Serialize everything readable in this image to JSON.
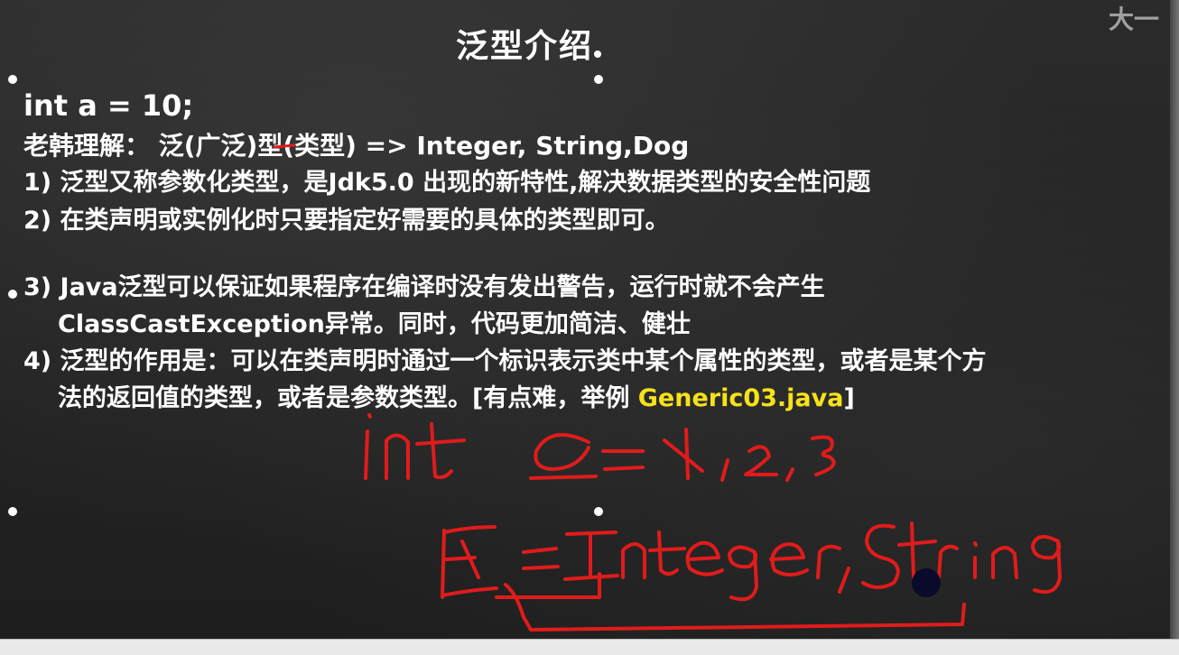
{
  "watermark": "大一",
  "title": "泛型介绍",
  "lines": {
    "l1": "int a = 10;",
    "l2": "老韩理解： 泛(广泛)型(类型) => Integer, String,Dog",
    "l3": "1) 泛型又称参数化类型，是Jdk5.0 出现的新特性,解决数据类型的安全性问题",
    "l4": "2) 在类声明或实例化时只要指定好需要的具体的类型即可。",
    "l5": "3) Java泛型可以保证如果程序在编译时没有发出警告，运行时就不会产生",
    "l6": "ClassCastException异常。同时，代码更加简洁、健壮",
    "l7": "4) 泛型的作用是：可以在类声明时通过一个标识表示类中某个属性的类型，或者是某个方",
    "l8_prefix": "法的返回值的类型，或者是参数类型。[有点难，举例 ",
    "l8_highlight": "Generic03.java",
    "l8_suffix": "]"
  },
  "handwriting": {
    "line1": "int a=1,2,3",
    "line2": "E=Integer,String"
  },
  "colors": {
    "text": "#ffffff",
    "highlight": "#f5e21b",
    "ink": "#e11b1b"
  }
}
